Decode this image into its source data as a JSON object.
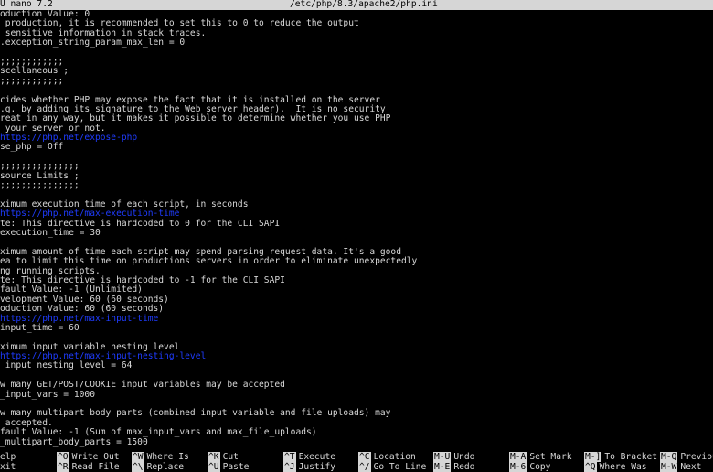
{
  "titlebar": {
    "app": "U nano 7.2",
    "file": "/etc/php/8.3/apache2/php.ini"
  },
  "editor": {
    "lines": [
      {
        "text": "oduction Value: 0",
        "type": "text"
      },
      {
        "text": " production, it is recommended to set this to 0 to reduce the output",
        "type": "text"
      },
      {
        "text": " sensitive information in stack traces.",
        "type": "text"
      },
      {
        "text": ".exception_string_param_max_len = 0",
        "type": "text"
      },
      {
        "text": "",
        "type": "text"
      },
      {
        "text": ";;;;;;;;;;;;",
        "type": "text"
      },
      {
        "text": "scellaneous ;",
        "type": "text"
      },
      {
        "text": ";;;;;;;;;;;;",
        "type": "text"
      },
      {
        "text": "",
        "type": "text"
      },
      {
        "text": "cides whether PHP may expose the fact that it is installed on the server",
        "type": "text"
      },
      {
        "text": ".g. by adding its signature to the Web server header).  It is no security",
        "type": "text"
      },
      {
        "text": "reat in any way, but it makes it possible to determine whether you use PHP",
        "type": "text"
      },
      {
        "text": " your server or not.",
        "type": "text"
      },
      {
        "text": "https://php.net/expose-php",
        "type": "url"
      },
      {
        "text": "se_php = Off",
        "type": "text"
      },
      {
        "text": "",
        "type": "text"
      },
      {
        "text": ";;;;;;;;;;;;;;;",
        "type": "text"
      },
      {
        "text": "source Limits ;",
        "type": "text"
      },
      {
        "text": ";;;;;;;;;;;;;;;",
        "type": "text"
      },
      {
        "text": "",
        "type": "text"
      },
      {
        "text": "ximum execution time of each script, in seconds",
        "type": "text"
      },
      {
        "text": "https://php.net/max-execution-time",
        "type": "url"
      },
      {
        "text": "te: This directive is hardcoded to 0 for the CLI SAPI",
        "type": "text"
      },
      {
        "text": "execution_time = 30",
        "type": "text"
      },
      {
        "text": "",
        "type": "text"
      },
      {
        "text": "ximum amount of time each script may spend parsing request data. It's a good",
        "type": "text"
      },
      {
        "text": "ea to limit this time on productions servers in order to eliminate unexpectedly",
        "type": "text"
      },
      {
        "text": "ng running scripts.",
        "type": "text"
      },
      {
        "text": "te: This directive is hardcoded to -1 for the CLI SAPI",
        "type": "text"
      },
      {
        "text": "fault Value: -1 (Unlimited)",
        "type": "text"
      },
      {
        "text": "velopment Value: 60 (60 seconds)",
        "type": "text"
      },
      {
        "text": "oduction Value: 60 (60 seconds)",
        "type": "text"
      },
      {
        "text": "https://php.net/max-input-time",
        "type": "url"
      },
      {
        "text": "input_time = 60",
        "type": "text"
      },
      {
        "text": "",
        "type": "text"
      },
      {
        "text": "ximum input variable nesting level",
        "type": "text"
      },
      {
        "text": "https://php.net/max-input-nesting-level",
        "type": "url"
      },
      {
        "text": "_input_nesting_level = 64",
        "type": "text"
      },
      {
        "text": "",
        "type": "text"
      },
      {
        "text": "w many GET/POST/COOKIE input variables may be accepted",
        "type": "text"
      },
      {
        "text": "_input_vars = 1000",
        "type": "text"
      },
      {
        "text": "",
        "type": "text"
      },
      {
        "text": "w many multipart body parts (combined input variable and file uploads) may",
        "type": "text"
      },
      {
        "text": " accepted.",
        "type": "text"
      },
      {
        "text": "fault Value: -1 (Sum of max_input_vars and max_file_uploads)",
        "type": "text"
      },
      {
        "text": "_multipart_body_parts = 1500",
        "type": "text"
      }
    ]
  },
  "shortcuts": {
    "row1": [
      {
        "key": "",
        "label": "elp"
      },
      {
        "key": "^O",
        "label": "Write Out"
      },
      {
        "key": "^W",
        "label": "Where Is"
      },
      {
        "key": "^K",
        "label": "Cut"
      },
      {
        "key": "^T",
        "label": "Execute"
      },
      {
        "key": "^C",
        "label": "Location"
      },
      {
        "key": "M-U",
        "label": "Undo"
      },
      {
        "key": "M-A",
        "label": "Set Mark"
      },
      {
        "key": "M-]",
        "label": "To Bracket"
      },
      {
        "key": "M-Q",
        "label": "Previous"
      }
    ],
    "row2": [
      {
        "key": "",
        "label": "xit"
      },
      {
        "key": "^R",
        "label": "Read File"
      },
      {
        "key": "^\\",
        "label": "Replace"
      },
      {
        "key": "^U",
        "label": "Paste"
      },
      {
        "key": "^J",
        "label": "Justify"
      },
      {
        "key": "^/",
        "label": "Go To Line"
      },
      {
        "key": "M-E",
        "label": "Redo"
      },
      {
        "key": "M-6",
        "label": "Copy"
      },
      {
        "key": "^Q",
        "label": "Where Was"
      },
      {
        "key": "M-W",
        "label": "Next"
      }
    ]
  }
}
